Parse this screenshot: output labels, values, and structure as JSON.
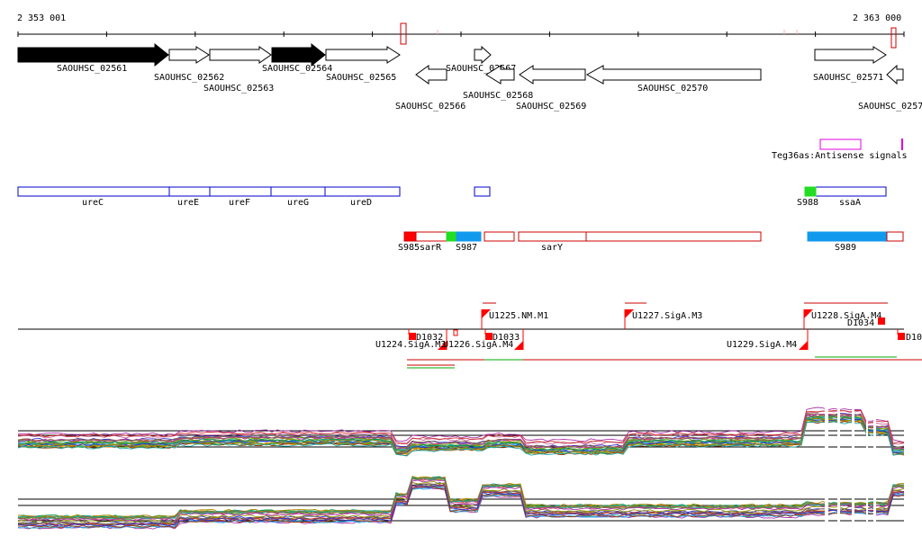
{
  "ruler": {
    "start_label": "2 353 001",
    "end_label": "2 363 000"
  },
  "genes": [
    {
      "label": "SAOUHSC_02561",
      "strand": "+",
      "filled": true
    },
    {
      "label": "SAOUHSC_02562",
      "strand": "+",
      "filled": false
    },
    {
      "label": "SAOUHSC_02563",
      "strand": "+",
      "filled": false
    },
    {
      "label": "SAOUHSC_02564",
      "strand": "+",
      "filled": true
    },
    {
      "label": "SAOUHSC_02565",
      "strand": "+",
      "filled": false
    },
    {
      "label": "SAOUHSC_02566",
      "strand": "-",
      "filled": false
    },
    {
      "label": "SAOUHSC_02567",
      "strand": "+",
      "filled": false
    },
    {
      "label": "SAOUHSC_02568",
      "strand": "-",
      "filled": false
    },
    {
      "label": "SAOUHSC_02569",
      "strand": "-",
      "filled": false
    },
    {
      "label": "SAOUHSC_02570",
      "strand": "-",
      "filled": false
    },
    {
      "label": "SAOUHSC_02571",
      "strand": "+",
      "filled": false
    },
    {
      "label": "SAOUHSC_0257",
      "strand": "-",
      "filled": false
    }
  ],
  "antisense": {
    "label": "Teg36as:Antisense signals",
    "color": "#e000e0"
  },
  "gene_names": [
    "ureC",
    "ureE",
    "ureF",
    "ureG",
    "ureD",
    "ssaA"
  ],
  "segments": [
    {
      "label": "S985",
      "color": "#ff0000"
    },
    {
      "label": "sarR",
      "color": "#ffffff"
    },
    {
      "label": "S987",
      "color": "#22dd22"
    },
    {
      "label": "sarY",
      "color": "#ffffff"
    },
    {
      "label": "S988",
      "color": "#22dd22"
    },
    {
      "label": "S989",
      "color": "#1199ee"
    }
  ],
  "promoters": [
    {
      "label": "U1225.NM.M1"
    },
    {
      "label": "U1227.SigA.M3"
    },
    {
      "label": "U1228.SigA.M4"
    },
    {
      "label": "U1224.SigA.M3"
    },
    {
      "label": "U1226.SigA.M4"
    },
    {
      "label": "U1229.SigA.M4"
    }
  ],
  "terminators": [
    {
      "label": "D1032"
    },
    {
      "label": "D1033"
    },
    {
      "label": "D1034"
    },
    {
      "label": "D10"
    }
  ],
  "colors": {
    "gene_outline": "#000000",
    "name_box": "#0000cc",
    "segment_box": "#cc0000",
    "promoter": "#ff0000",
    "transcript_red": "#cc0000",
    "transcript_green": "#00aa00"
  }
}
